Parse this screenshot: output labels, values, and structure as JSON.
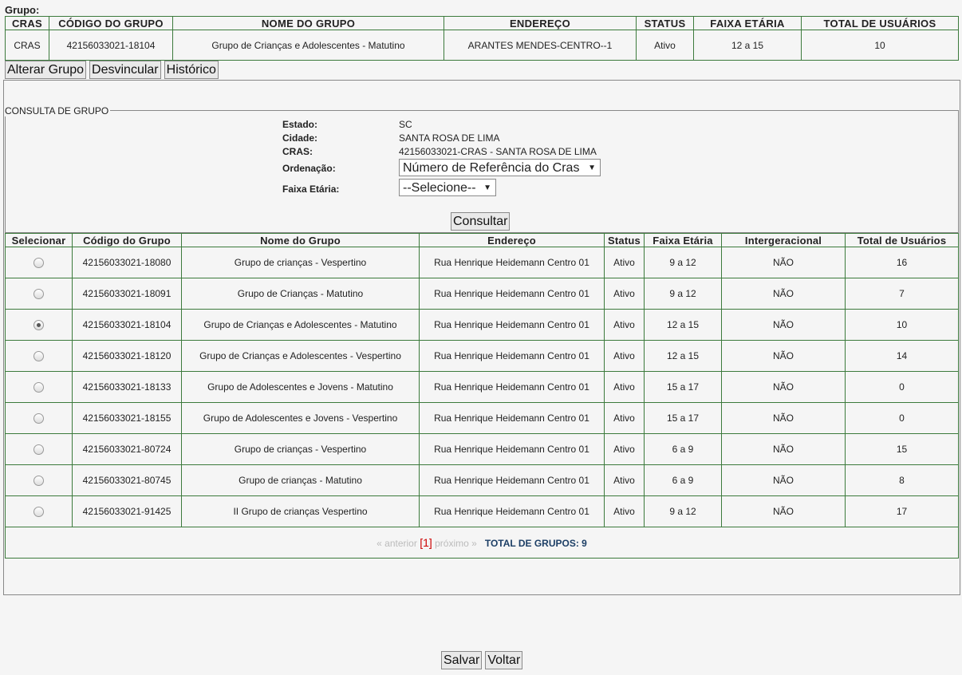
{
  "grupo": {
    "label": "Grupo:",
    "headers": [
      "CRAS",
      "CÓDIGO DO GRUPO",
      "NOME DO GRUPO",
      "ENDEREÇO",
      "STATUS",
      "FAIXA ETÁRIA",
      "TOTAL DE USUÁRIOS"
    ],
    "row": [
      "CRAS",
      "42156033021-18104",
      "Grupo de Crianças e Adolescentes - Matutino",
      "ARANTES MENDES-CENTRO--1",
      "Ativo",
      "12 a 15",
      "10"
    ]
  },
  "actions": {
    "alterar": "Alterar Grupo",
    "desvincular": "Desvincular",
    "historico": "Histórico"
  },
  "consulta": {
    "legend": "CONSULTA DE GRUPO",
    "estado_label": "Estado:",
    "estado_value": "SC",
    "cidade_label": "Cidade:",
    "cidade_value": "SANTA ROSA DE LIMA",
    "cras_label": "CRAS:",
    "cras_value": "42156033021-CRAS - SANTA ROSA DE LIMA",
    "ordenacao_label": "Ordenação:",
    "ordenacao_value": "Número de Referência do Cras",
    "faixa_label": "Faixa Etária:",
    "faixa_value": "--Selecione--",
    "consultar_label": "Consultar"
  },
  "list": {
    "headers": [
      "Selecionar",
      "Código do Grupo",
      "Nome do Grupo",
      "Endereço",
      "Status",
      "Faixa Etária",
      "Intergeracional",
      "Total de Usuários"
    ],
    "rows": [
      {
        "selected": false,
        "codigo": "42156033021-18080",
        "nome": "Grupo de crianças - Vespertino",
        "endereco": "Rua Henrique Heidemann Centro 01",
        "status": "Ativo",
        "faixa": "9 a 12",
        "inter": "NÃO",
        "total": "16"
      },
      {
        "selected": false,
        "codigo": "42156033021-18091",
        "nome": "Grupo de Crianças - Matutino",
        "endereco": "Rua Henrique Heidemann Centro 01",
        "status": "Ativo",
        "faixa": "9 a 12",
        "inter": "NÃO",
        "total": "7"
      },
      {
        "selected": true,
        "codigo": "42156033021-18104",
        "nome": "Grupo de Crianças e Adolescentes - Matutino",
        "endereco": "Rua Henrique Heidemann Centro 01",
        "status": "Ativo",
        "faixa": "12 a 15",
        "inter": "NÃO",
        "total": "10"
      },
      {
        "selected": false,
        "codigo": "42156033021-18120",
        "nome": "Grupo de Crianças e Adolescentes - Vespertino",
        "endereco": "Rua Henrique Heidemann Centro 01",
        "status": "Ativo",
        "faixa": "12 a 15",
        "inter": "NÃO",
        "total": "14"
      },
      {
        "selected": false,
        "codigo": "42156033021-18133",
        "nome": "Grupo de Adolescentes e Jovens - Matutino",
        "endereco": "Rua Henrique Heidemann Centro 01",
        "status": "Ativo",
        "faixa": "15 a 17",
        "inter": "NÃO",
        "total": "0"
      },
      {
        "selected": false,
        "codigo": "42156033021-18155",
        "nome": "Grupo de Adolescentes e Jovens - Vespertino",
        "endereco": "Rua Henrique Heidemann Centro 01",
        "status": "Ativo",
        "faixa": "15 a 17",
        "inter": "NÃO",
        "total": "0"
      },
      {
        "selected": false,
        "codigo": "42156033021-80724",
        "nome": "Grupo de crianças - Vespertino",
        "endereco": "Rua Henrique Heidemann Centro 01",
        "status": "Ativo",
        "faixa": "6 a 9",
        "inter": "NÃO",
        "total": "15"
      },
      {
        "selected": false,
        "codigo": "42156033021-80745",
        "nome": "Grupo de crianças - Matutino",
        "endereco": "Rua Henrique Heidemann Centro 01",
        "status": "Ativo",
        "faixa": "6 a 9",
        "inter": "NÃO",
        "total": "8"
      },
      {
        "selected": false,
        "codigo": "42156033021-91425",
        "nome": "II Grupo de crianças Vespertino",
        "endereco": "Rua Henrique Heidemann Centro 01",
        "status": "Ativo",
        "faixa": "9 a 12",
        "inter": "NÃO",
        "total": "17"
      }
    ]
  },
  "pager": {
    "prev": "« anterior",
    "current": "[1]",
    "next": "próximo »",
    "total_groups": "TOTAL DE GRUPOS: 9"
  },
  "footer": {
    "salvar": "Salvar",
    "voltar": "Voltar"
  }
}
